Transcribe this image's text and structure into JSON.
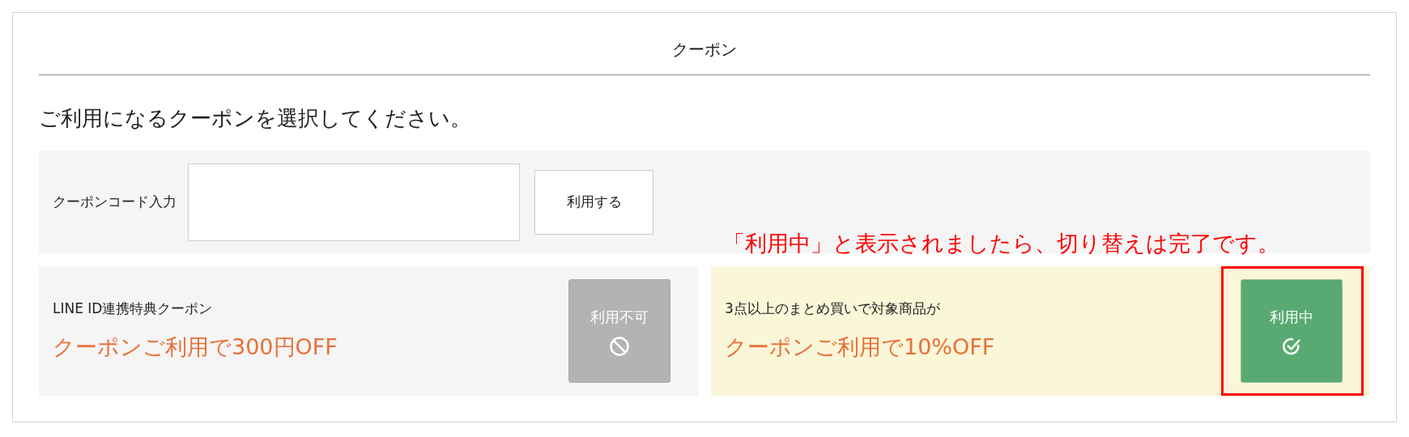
{
  "title": "クーポン",
  "instruction": "ご利用になるクーポンを選択してください。",
  "code_entry": {
    "label": "クーポンコード入力",
    "button": "利用する"
  },
  "annotation": "「利用中」と表示されましたら、切り替えは完了です。",
  "coupons": [
    {
      "name": "LINE ID連携特典クーポン",
      "offer": "クーポンご利用で300円OFF",
      "kind": "unavailable",
      "button": "利用不可",
      "highlighted": false
    },
    {
      "name": "3点以上のまとめ買いで対象商品が",
      "offer": "クーポンご利用で10%OFF",
      "kind": "in_use",
      "button": "利用中",
      "highlighted": true
    }
  ]
}
